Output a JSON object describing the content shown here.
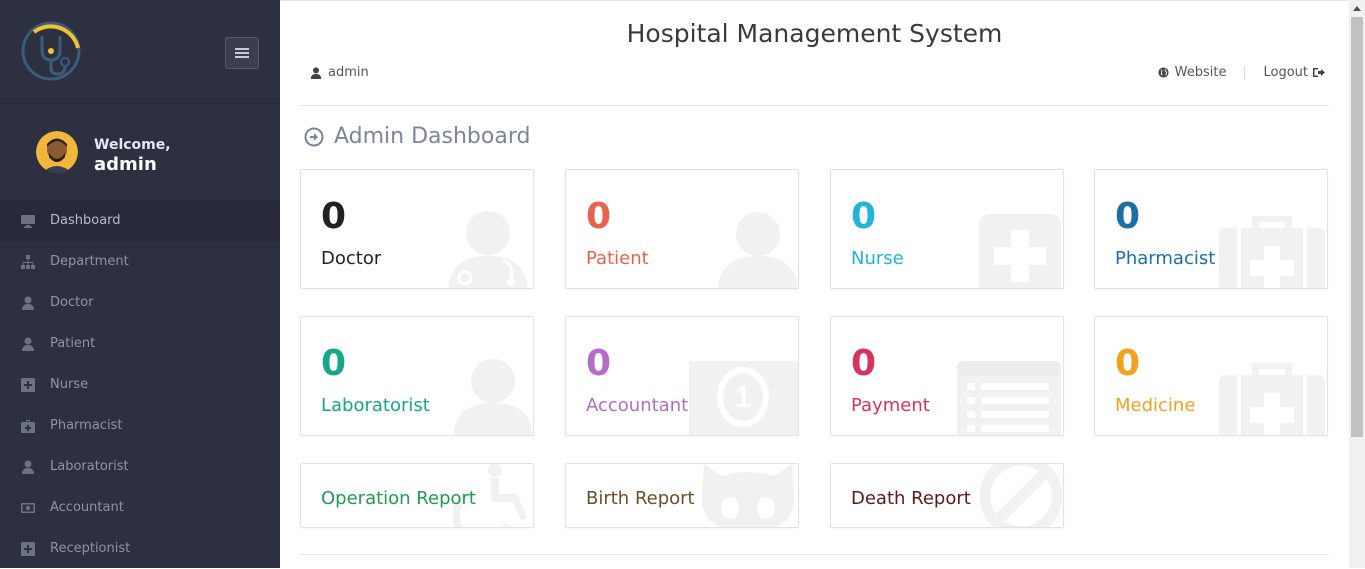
{
  "app": {
    "title": "Hospital Management System"
  },
  "sidebar": {
    "welcome_label": "Welcome,",
    "username": "admin",
    "items": [
      {
        "label": "Dashboard",
        "icon": "monitor-icon",
        "active": true
      },
      {
        "label": "Department",
        "icon": "sitemap-icon"
      },
      {
        "label": "Doctor",
        "icon": "user-md-icon"
      },
      {
        "label": "Patient",
        "icon": "user-icon"
      },
      {
        "label": "Nurse",
        "icon": "plus-square-icon"
      },
      {
        "label": "Pharmacist",
        "icon": "medkit-icon"
      },
      {
        "label": "Laboratorist",
        "icon": "user-icon"
      },
      {
        "label": "Accountant",
        "icon": "money-icon"
      },
      {
        "label": "Receptionist",
        "icon": "plus-square-icon"
      }
    ]
  },
  "header": {
    "user": "admin",
    "website": "Website",
    "logout": "Logout"
  },
  "dashboard": {
    "title": "Admin Dashboard",
    "cards": [
      {
        "count": "0",
        "label": "Doctor",
        "color": "#222222",
        "icon": "user-md-icon"
      },
      {
        "count": "0",
        "label": "Patient",
        "color": "#e8634f",
        "icon": "user-icon"
      },
      {
        "count": "0",
        "label": "Nurse",
        "color": "#1fb5d6",
        "icon": "plus-square-icon"
      },
      {
        "count": "0",
        "label": "Pharmacist",
        "color": "#1b6fa7",
        "icon": "medkit-icon"
      },
      {
        "count": "0",
        "label": "Laboratorist",
        "color": "#16a68b",
        "icon": "user-icon"
      },
      {
        "count": "0",
        "label": "Accountant",
        "color": "#b56cc8",
        "icon": "money-icon"
      },
      {
        "count": "0",
        "label": "Payment",
        "color": "#d6335f",
        "icon": "list-alt-icon"
      },
      {
        "count": "0",
        "label": "Medicine",
        "color": "#f3a11f",
        "icon": "medkit-icon"
      }
    ],
    "reports": [
      {
        "label": "Operation Report",
        "color": "#1f9a55",
        "icon": "wheelchair-icon"
      },
      {
        "label": "Birth Report",
        "color": "#6b4f2a",
        "icon": "github-alt-icon"
      },
      {
        "label": "Death Report",
        "color": "#5a1a1a",
        "icon": "ban-icon"
      }
    ]
  }
}
